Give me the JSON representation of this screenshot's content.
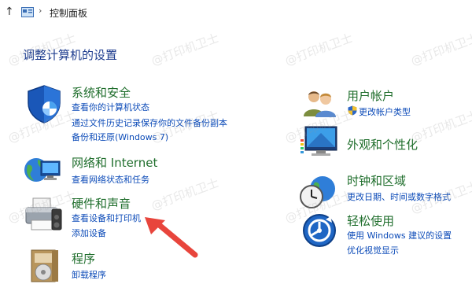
{
  "address_bar": {
    "up_arrow": "↑",
    "breadcrumb": "控制面板"
  },
  "page_title": "调整计算机的设置",
  "categories": [
    {
      "title": "系统和安全",
      "links": [
        "查看你的计算机状态",
        "通过文件历史记录保存你的文件备份副本",
        "备份和还原(Windows 7)"
      ],
      "icon": "shield-icon"
    },
    {
      "title": "网络和 Internet",
      "links": [
        "查看网络状态和任务"
      ],
      "icon": "network-icon"
    },
    {
      "title": "硬件和声音",
      "links": [
        "查看设备和打印机",
        "添加设备"
      ],
      "icon": "printer-icon"
    },
    {
      "title": "程序",
      "links": [
        "卸载程序"
      ],
      "icon": "programs-icon"
    },
    {
      "title": "用户帐户",
      "links": [
        "更改帐户类型"
      ],
      "icon": "users-icon"
    },
    {
      "title": "外观和个性化",
      "links": [],
      "icon": "monitor-icon"
    },
    {
      "title": "时钟和区域",
      "links": [
        "更改日期、时间或数字格式"
      ],
      "icon": "clock-globe-icon"
    },
    {
      "title": "轻松使用",
      "links": [
        "使用 Windows 建议的设置",
        "优化视觉显示"
      ],
      "icon": "ease-of-access-icon"
    }
  ],
  "watermark_text": "@打印机卫士",
  "colors": {
    "category_title": "#1f6e2c",
    "link": "#0c4bb8",
    "page_title": "#1e3d8f",
    "annotation_arrow": "#e8453c"
  }
}
